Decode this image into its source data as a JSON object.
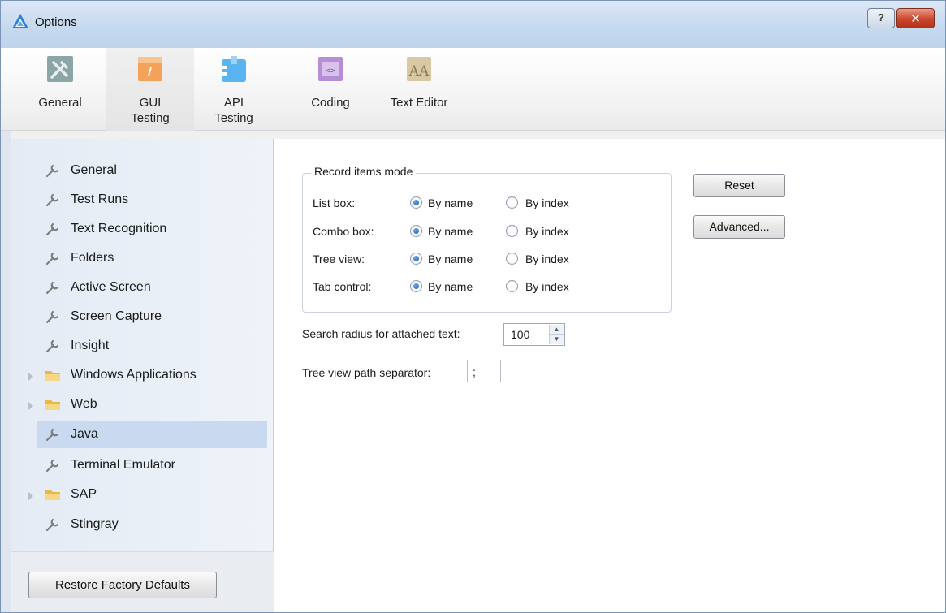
{
  "window": {
    "title": "Options",
    "help_label": "?",
    "close_label": "✕"
  },
  "toolbar": {
    "categories": [
      {
        "label": "General",
        "icon": "tools-icon"
      },
      {
        "label": "GUI\nTesting",
        "icon": "gui-testing-icon",
        "selected": true
      },
      {
        "label": "API\nTesting",
        "icon": "api-testing-icon"
      },
      {
        "label": "Coding",
        "icon": "coding-icon"
      },
      {
        "label": "Text Editor",
        "icon": "text-editor-icon"
      }
    ]
  },
  "tree": {
    "items": [
      {
        "label": "General",
        "icon": "wrench-icon"
      },
      {
        "label": "Test Runs",
        "icon": "wrench-icon"
      },
      {
        "label": "Text Recognition",
        "icon": "wrench-icon"
      },
      {
        "label": "Folders",
        "icon": "wrench-icon"
      },
      {
        "label": "Active Screen",
        "icon": "wrench-icon"
      },
      {
        "label": "Screen Capture",
        "icon": "wrench-icon"
      },
      {
        "label": "Insight",
        "icon": "wrench-icon"
      },
      {
        "label": "Windows Applications",
        "icon": "folder-icon",
        "expandable": true
      },
      {
        "label": "Web",
        "icon": "folder-icon",
        "expandable": true
      },
      {
        "label": "Java",
        "icon": "wrench-icon",
        "selected": true
      },
      {
        "label": "Terminal Emulator",
        "icon": "wrench-icon"
      },
      {
        "label": "SAP",
        "icon": "folder-icon",
        "expandable": true
      },
      {
        "label": "Stingray",
        "icon": "wrench-icon"
      }
    ]
  },
  "content": {
    "group_title": "Record items mode",
    "option_by_name": "By name",
    "option_by_index": "By index",
    "rows": [
      {
        "label": "List box:",
        "selected": "By name"
      },
      {
        "label": "Combo box:",
        "selected": "By name"
      },
      {
        "label": "Tree view:",
        "selected": "By name"
      },
      {
        "label": "Tab control:",
        "selected": "By name"
      }
    ],
    "reset_label": "Reset",
    "advanced_label": "Advanced...",
    "search_radius_label": "Search radius for attached text:",
    "search_radius_value": "100",
    "separator_label": "Tree view path separator:",
    "separator_value": ";"
  },
  "footer": {
    "restore_label": "Restore Factory Defaults"
  },
  "colors": {
    "accent": "#1d5fb7",
    "selection": "#c9d9ef",
    "folder": "#e8b94a"
  }
}
